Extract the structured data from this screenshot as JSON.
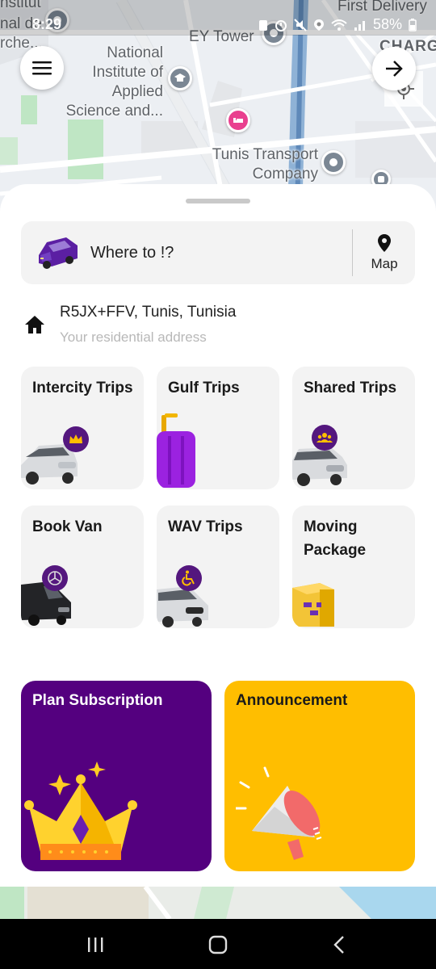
{
  "status_bar": {
    "time": "8:29",
    "battery": "58%"
  },
  "map": {
    "labels": {
      "top_left_1": "nstitut",
      "top_left_2": "nal de",
      "top_left_3": "rche...",
      "first_delivery": "First Delivery",
      "ey_tower": "EY Tower",
      "charg": "CHARG",
      "national_institute": "National\nInstitute of\nApplied\nScience and...",
      "tunis_transport": "Tunis Transport\nCompany"
    }
  },
  "search": {
    "placeholder": "Where to !?",
    "map_label": "Map"
  },
  "home": {
    "address": "R5JX+FFV, Tunis, Tunisia",
    "subtitle": "Your residential address"
  },
  "tiles": [
    {
      "title": "Intercity Trips",
      "icon": "crown-icon"
    },
    {
      "title": "Gulf Trips",
      "icon": "suitcase-icon"
    },
    {
      "title": "Shared Trips",
      "icon": "group-icon"
    },
    {
      "title": "Book Van",
      "icon": "mercedes-icon"
    },
    {
      "title": "WAV Trips",
      "icon": "wheelchair-icon"
    },
    {
      "title": "Moving Package",
      "icon": "box-icon"
    }
  ],
  "cards": [
    {
      "title": "Plan Subscription",
      "color": "#54007f"
    },
    {
      "title": "Announcement",
      "color": "#ffbe00"
    }
  ],
  "colors": {
    "accent_purple": "#54177e",
    "accent_yellow": "#ffbe00"
  }
}
